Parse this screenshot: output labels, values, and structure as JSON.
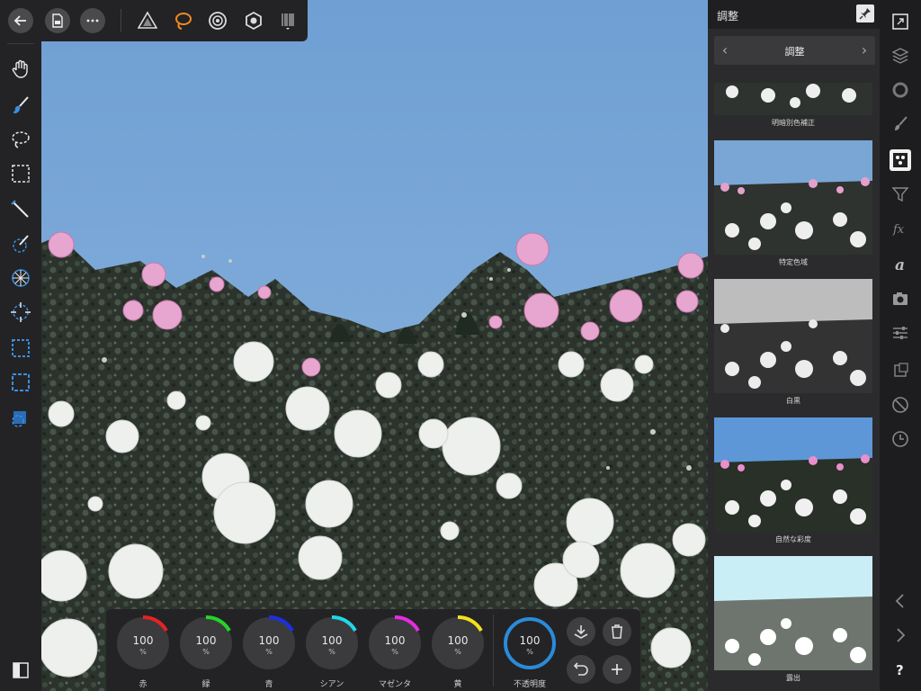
{
  "panel": {
    "title": "調整",
    "category": "調整",
    "presets": [
      {
        "label": "明暗別色補正"
      },
      {
        "label": "特定色域"
      },
      {
        "label": "白黒"
      },
      {
        "label": "自然な彩度"
      },
      {
        "label": "露出"
      }
    ]
  },
  "bottom_bar": {
    "channels": [
      {
        "label": "赤",
        "value": "100",
        "unit": "%",
        "color": "#e52323"
      },
      {
        "label": "緑",
        "value": "100",
        "unit": "%",
        "color": "#21d629"
      },
      {
        "label": "青",
        "value": "100",
        "unit": "%",
        "color": "#1b2fe6"
      },
      {
        "label": "シアン",
        "value": "100",
        "unit": "%",
        "color": "#21d7e8"
      },
      {
        "label": "マゼンタ",
        "value": "100",
        "unit": "%",
        "color": "#e62ce0"
      },
      {
        "label": "黄",
        "value": "100",
        "unit": "%",
        "color": "#f0e21c"
      }
    ],
    "opacity": {
      "label": "不透明度",
      "value": "100",
      "unit": "%",
      "color": "#2a8bd9"
    }
  },
  "top_toolbar": {
    "icons": [
      "back-icon",
      "document-icon",
      "more-icon",
      "pixel-persona-icon",
      "selection-brush-persona-icon",
      "liquify-persona-icon",
      "develop-persona-icon",
      "export-persona-icon"
    ]
  },
  "left_toolbar": {
    "icons": [
      "hand-icon",
      "paint-brush-icon",
      "freehand-selection-icon",
      "rectangular-marquee-icon",
      "magic-wand-icon",
      "flood-select-icon",
      "sphere-tool-icon",
      "target-tool-icon",
      "rectangle-selection-icon",
      "dashed-square-icon",
      "quick-mask-icon",
      "toggle-panel-icon"
    ]
  },
  "studio_tabs": {
    "icons": [
      "navigator-icon",
      "layers-icon",
      "color-icon",
      "brushes-icon",
      "adjustments-icon",
      "filters-icon",
      "fx-icon",
      "text-icon",
      "camera-icon",
      "sliders-icon",
      "transform-icon",
      "prohibited-icon",
      "history-icon",
      "chevron-left-icon",
      "chevron-right-icon",
      "help-icon"
    ]
  },
  "colors": {
    "accent": "#f08a24",
    "panel_bg": "#2b2b2d",
    "toolbar_bg": "#232325",
    "sky": "#7aa6d6"
  }
}
